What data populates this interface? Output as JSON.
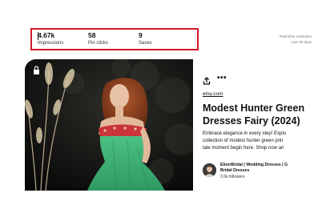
{
  "stats": [
    {
      "value": "4.67k",
      "label": "Impressions"
    },
    {
      "value": "58",
      "label": "Pin clicks"
    },
    {
      "value": "9",
      "label": "Saves"
    }
  ],
  "realtime": {
    "line1": "Real-time estimates",
    "line2": "Last 30 days"
  },
  "pin": {
    "source": "etsy.com",
    "title_line1": "Modest Hunter Green",
    "title_line2": "Dresses Fairy (2024)",
    "desc_line1": "Embrace elegance in every step! Explo",
    "desc_line2": "collection of modest hunter green prin",
    "desc_line3": "tale moment begin here. Shop now an"
  },
  "creator": {
    "name_line1": "ElnorBridal | Wedding Dresses | G",
    "name_line2": "Bridal Dresses",
    "followers": "2.6k followers"
  },
  "icons": {
    "share": "share-icon",
    "more": "more-icon",
    "lock": "lock-icon"
  },
  "colors": {
    "highlight_border": "#d0182a",
    "dress": "#3fae74"
  }
}
